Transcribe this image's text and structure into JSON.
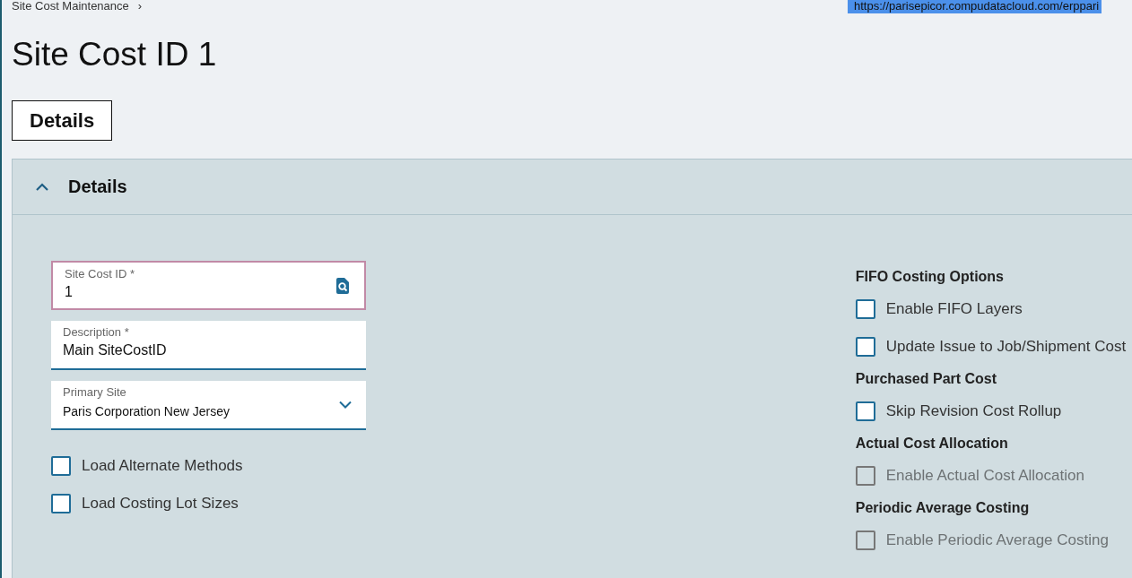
{
  "breadcrumb": {
    "label": "Site Cost Maintenance",
    "separator": "›"
  },
  "url_tooltip": "https://parisepicor.compudatacloud.com/erppari",
  "title": "Site Cost ID 1",
  "tabs": [
    {
      "label": "Details",
      "selected": true
    }
  ],
  "panel": {
    "title": "Details",
    "expanded": true,
    "fields": [
      {
        "kind": "lookup",
        "label": "Site Cost ID *",
        "value": "1",
        "focused": true
      },
      {
        "kind": "text",
        "label": "Description *",
        "value": "Main SiteCostID",
        "focused": false
      },
      {
        "kind": "dropdown",
        "label": "Primary Site",
        "value": "Paris Corporation New Jersey",
        "focused": false
      }
    ],
    "left_options": [
      {
        "label": "Load Alternate Methods",
        "checked": false,
        "disabled": false
      },
      {
        "label": "Load Costing Lot Sizes",
        "checked": false,
        "disabled": false
      }
    ],
    "sections": [
      {
        "title": "FIFO Costing Options",
        "options": [
          {
            "label": "Enable FIFO Layers",
            "checked": false,
            "disabled": false
          },
          {
            "label": "Update Issue to Job/Shipment Cost",
            "checked": false,
            "disabled": false
          }
        ]
      },
      {
        "title": "Purchased Part Cost",
        "options": [
          {
            "label": "Skip Revision Cost Rollup",
            "checked": false,
            "disabled": false
          }
        ]
      },
      {
        "title": "Actual Cost Allocation",
        "options": [
          {
            "label": "Enable Actual Cost Allocation",
            "checked": false,
            "disabled": true
          }
        ]
      },
      {
        "title": "Periodic Average Costing",
        "options": [
          {
            "label": "Enable Periodic Average Costing",
            "checked": false,
            "disabled": true
          }
        ]
      }
    ]
  }
}
